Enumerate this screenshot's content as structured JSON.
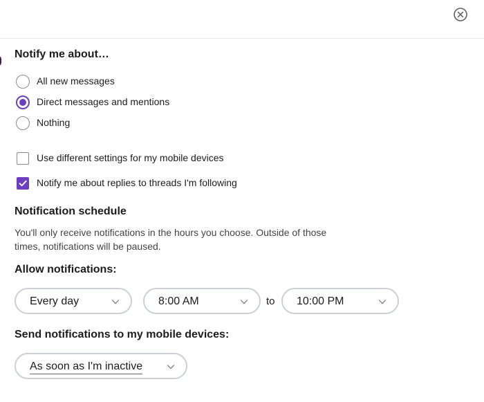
{
  "header": {
    "close_icon": "close-circle-icon"
  },
  "notify": {
    "heading": "Notify me about…",
    "options": [
      {
        "label": "All new messages",
        "selected": false
      },
      {
        "label": "Direct messages and mentions",
        "selected": true
      },
      {
        "label": "Nothing",
        "selected": false
      }
    ]
  },
  "checkboxes": {
    "mobile_label": "Use different settings for my mobile devices",
    "mobile_checked": false,
    "threads_label": "Notify me about replies to threads I'm following",
    "threads_checked": true
  },
  "schedule": {
    "heading": "Notification schedule",
    "description": "You'll only receive notifications in the hours you choose. Outside of those times, notifications will be paused.",
    "allow_label": "Allow notifications:",
    "days_value": "Every day",
    "from_value": "8:00 AM",
    "to_text": "to",
    "until_value": "10:00 PM"
  },
  "mobile": {
    "heading": "Send notifications to my mobile devices:",
    "value": "As soon as I'm inactive"
  },
  "colors": {
    "accent": "#6d3fc0",
    "border": "#c9d0d6"
  }
}
